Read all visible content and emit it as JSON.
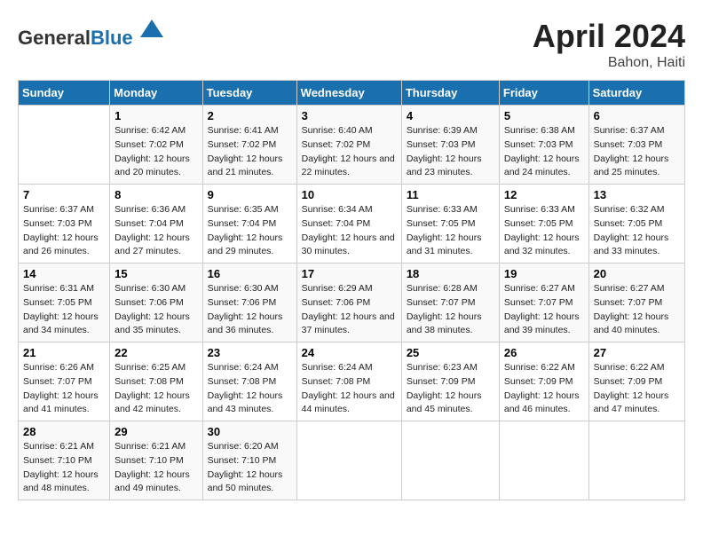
{
  "header": {
    "logo_general": "General",
    "logo_blue": "Blue",
    "title": "April 2024",
    "subtitle": "Bahon, Haiti"
  },
  "days_of_week": [
    "Sunday",
    "Monday",
    "Tuesday",
    "Wednesday",
    "Thursday",
    "Friday",
    "Saturday"
  ],
  "weeks": [
    [
      {
        "day": "",
        "sunrise": "",
        "sunset": "",
        "daylight": ""
      },
      {
        "day": "1",
        "sunrise": "6:42 AM",
        "sunset": "7:02 PM",
        "daylight": "12 hours and 20 minutes."
      },
      {
        "day": "2",
        "sunrise": "6:41 AM",
        "sunset": "7:02 PM",
        "daylight": "12 hours and 21 minutes."
      },
      {
        "day": "3",
        "sunrise": "6:40 AM",
        "sunset": "7:02 PM",
        "daylight": "12 hours and 22 minutes."
      },
      {
        "day": "4",
        "sunrise": "6:39 AM",
        "sunset": "7:03 PM",
        "daylight": "12 hours and 23 minutes."
      },
      {
        "day": "5",
        "sunrise": "6:38 AM",
        "sunset": "7:03 PM",
        "daylight": "12 hours and 24 minutes."
      },
      {
        "day": "6",
        "sunrise": "6:37 AM",
        "sunset": "7:03 PM",
        "daylight": "12 hours and 25 minutes."
      }
    ],
    [
      {
        "day": "7",
        "sunrise": "6:37 AM",
        "sunset": "7:03 PM",
        "daylight": "12 hours and 26 minutes."
      },
      {
        "day": "8",
        "sunrise": "6:36 AM",
        "sunset": "7:04 PM",
        "daylight": "12 hours and 27 minutes."
      },
      {
        "day": "9",
        "sunrise": "6:35 AM",
        "sunset": "7:04 PM",
        "daylight": "12 hours and 29 minutes."
      },
      {
        "day": "10",
        "sunrise": "6:34 AM",
        "sunset": "7:04 PM",
        "daylight": "12 hours and 30 minutes."
      },
      {
        "day": "11",
        "sunrise": "6:33 AM",
        "sunset": "7:05 PM",
        "daylight": "12 hours and 31 minutes."
      },
      {
        "day": "12",
        "sunrise": "6:33 AM",
        "sunset": "7:05 PM",
        "daylight": "12 hours and 32 minutes."
      },
      {
        "day": "13",
        "sunrise": "6:32 AM",
        "sunset": "7:05 PM",
        "daylight": "12 hours and 33 minutes."
      }
    ],
    [
      {
        "day": "14",
        "sunrise": "6:31 AM",
        "sunset": "7:05 PM",
        "daylight": "12 hours and 34 minutes."
      },
      {
        "day": "15",
        "sunrise": "6:30 AM",
        "sunset": "7:06 PM",
        "daylight": "12 hours and 35 minutes."
      },
      {
        "day": "16",
        "sunrise": "6:30 AM",
        "sunset": "7:06 PM",
        "daylight": "12 hours and 36 minutes."
      },
      {
        "day": "17",
        "sunrise": "6:29 AM",
        "sunset": "7:06 PM",
        "daylight": "12 hours and 37 minutes."
      },
      {
        "day": "18",
        "sunrise": "6:28 AM",
        "sunset": "7:07 PM",
        "daylight": "12 hours and 38 minutes."
      },
      {
        "day": "19",
        "sunrise": "6:27 AM",
        "sunset": "7:07 PM",
        "daylight": "12 hours and 39 minutes."
      },
      {
        "day": "20",
        "sunrise": "6:27 AM",
        "sunset": "7:07 PM",
        "daylight": "12 hours and 40 minutes."
      }
    ],
    [
      {
        "day": "21",
        "sunrise": "6:26 AM",
        "sunset": "7:07 PM",
        "daylight": "12 hours and 41 minutes."
      },
      {
        "day": "22",
        "sunrise": "6:25 AM",
        "sunset": "7:08 PM",
        "daylight": "12 hours and 42 minutes."
      },
      {
        "day": "23",
        "sunrise": "6:24 AM",
        "sunset": "7:08 PM",
        "daylight": "12 hours and 43 minutes."
      },
      {
        "day": "24",
        "sunrise": "6:24 AM",
        "sunset": "7:08 PM",
        "daylight": "12 hours and 44 minutes."
      },
      {
        "day": "25",
        "sunrise": "6:23 AM",
        "sunset": "7:09 PM",
        "daylight": "12 hours and 45 minutes."
      },
      {
        "day": "26",
        "sunrise": "6:22 AM",
        "sunset": "7:09 PM",
        "daylight": "12 hours and 46 minutes."
      },
      {
        "day": "27",
        "sunrise": "6:22 AM",
        "sunset": "7:09 PM",
        "daylight": "12 hours and 47 minutes."
      }
    ],
    [
      {
        "day": "28",
        "sunrise": "6:21 AM",
        "sunset": "7:10 PM",
        "daylight": "12 hours and 48 minutes."
      },
      {
        "day": "29",
        "sunrise": "6:21 AM",
        "sunset": "7:10 PM",
        "daylight": "12 hours and 49 minutes."
      },
      {
        "day": "30",
        "sunrise": "6:20 AM",
        "sunset": "7:10 PM",
        "daylight": "12 hours and 50 minutes."
      },
      {
        "day": "",
        "sunrise": "",
        "sunset": "",
        "daylight": ""
      },
      {
        "day": "",
        "sunrise": "",
        "sunset": "",
        "daylight": ""
      },
      {
        "day": "",
        "sunrise": "",
        "sunset": "",
        "daylight": ""
      },
      {
        "day": "",
        "sunrise": "",
        "sunset": "",
        "daylight": ""
      }
    ]
  ]
}
